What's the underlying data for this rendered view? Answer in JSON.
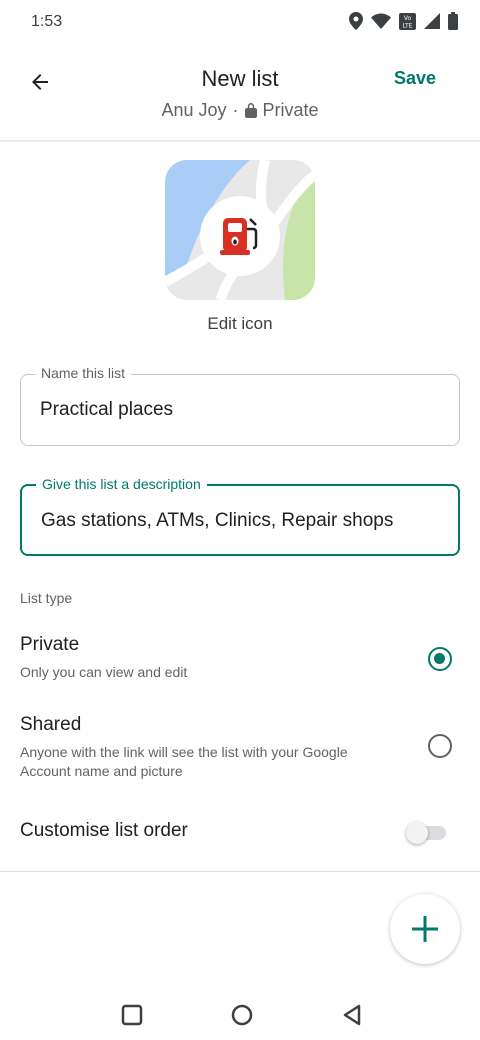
{
  "status_bar": {
    "time": "1:53",
    "icons": [
      "location-icon",
      "wifi-icon",
      "volte-icon",
      "signal-icon",
      "battery-icon"
    ]
  },
  "header": {
    "title": "New list",
    "owner": "Anu Joy",
    "separator": "·",
    "visibility": "Private",
    "save_label": "Save"
  },
  "list_icon": {
    "icon": "gas-station-icon",
    "edit_label": "Edit icon"
  },
  "form": {
    "name_label": "Name this list",
    "name_value": "Practical places",
    "description_label": "Give this list a description",
    "description_value": "Gas stations, ATMs, Clinics, Repair shops"
  },
  "list_type": {
    "heading": "List type",
    "options": [
      {
        "title": "Private",
        "description": "Only you can view and edit",
        "selected": true
      },
      {
        "title": "Shared",
        "description": "Anyone with the link will see the list with your Google Account name and picture",
        "selected": false
      }
    ]
  },
  "order": {
    "label": "Customise list order",
    "enabled": false
  },
  "colors": {
    "accent": "#00796b",
    "map_blue": "#a9cdf7",
    "map_green": "#c8e4a8",
    "map_gray": "#e8e8e8",
    "pump_red": "#d93025"
  }
}
